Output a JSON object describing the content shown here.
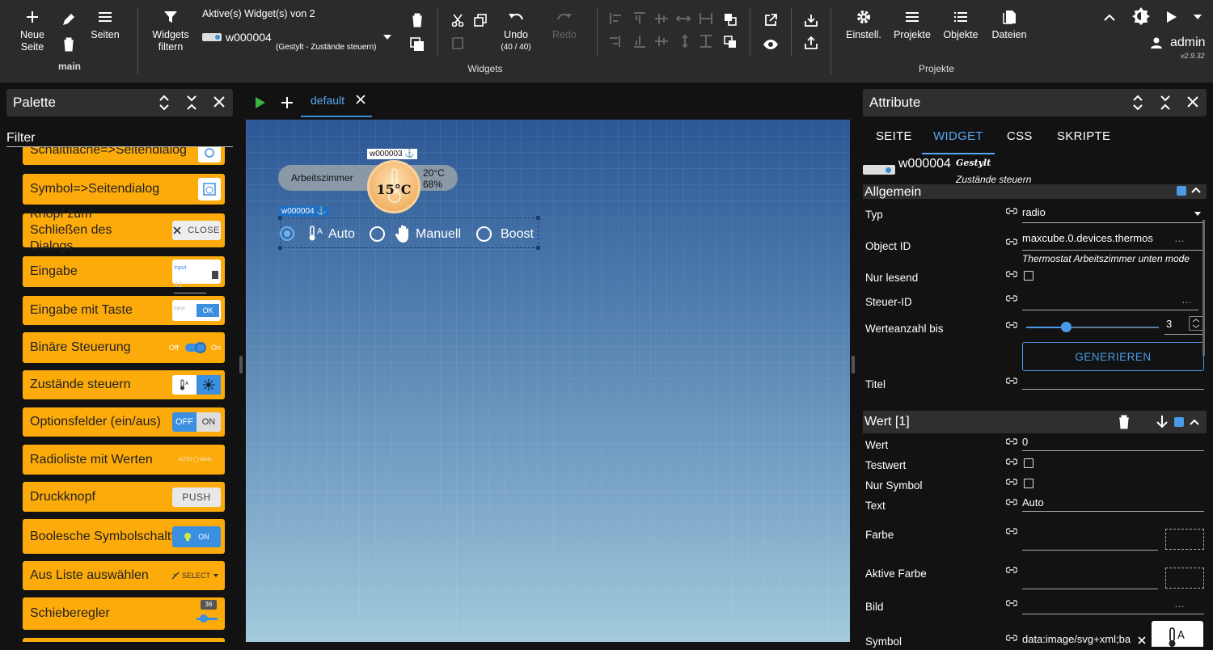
{
  "toolbar": {
    "new_page": "Neue\nSeite",
    "pages": "Seiten",
    "group_main": "main",
    "filter": "Widgets\nfiltern",
    "active_label": "Aktive(s) Widget(s) von 2",
    "widget_id": "w000004",
    "widget_desc": "(Gestylt - Zustände steuern)",
    "undo": "Undo",
    "undo_count": "(40 / 40)",
    "redo": "Redo",
    "group_widgets": "Widgets",
    "settings": "Einstell.",
    "projects": "Projekte",
    "objects": "Objekte",
    "files": "Dateien",
    "group_projects": "Projekte",
    "user": "admin",
    "version": "v2.9.32"
  },
  "palette": {
    "title": "Palette",
    "filter": "Filter",
    "items": [
      {
        "label": "Schaltfläche=>Seitendialog"
      },
      {
        "label": "Symbol=>Seitendialog"
      },
      {
        "label": "Knopf zum Schließen des Dialogs",
        "preview": "CLOSE"
      },
      {
        "label": "Eingabe",
        "preview_label": "Input",
        "preview_value": "42"
      },
      {
        "label": "Eingabe mit Taste",
        "preview_label": "Input",
        "preview_btn": "OK"
      },
      {
        "label": "Binäre Steuerung",
        "off": "Off",
        "on": "On"
      },
      {
        "label": "Zustände steuern"
      },
      {
        "label": "Optionsfelder (ein/aus)",
        "off": "OFF",
        "on": "ON"
      },
      {
        "label": "Radioliste mit Werten",
        "preview": "AUTO ◯ MAN"
      },
      {
        "label": "Druckknopf",
        "preview": "PUSH"
      },
      {
        "label": "Boolesche Symbolschaltfläche",
        "preview": "ON"
      },
      {
        "label": "Aus Liste auswählen",
        "preview": "SELECT"
      },
      {
        "label": "Schieberegler",
        "preview": "36"
      }
    ]
  },
  "editor": {
    "tab": "default",
    "w3": {
      "id": "w000003",
      "room": "Arbeitszimmer",
      "temp": "15°C",
      "setpoint": "20°C",
      "humidity": "68%"
    },
    "w4": {
      "id": "w000004",
      "options": [
        "Auto",
        "Manuell",
        "Boost"
      ]
    }
  },
  "attributes": {
    "title": "Attribute",
    "tabs": [
      "SEITE",
      "WIDGET",
      "CSS",
      "SKRIPTE"
    ],
    "widget_id": "w000004",
    "widget_style": "Gestylt",
    "widget_name": "Zustände steuern",
    "general": {
      "title": "Allgemein",
      "type_label": "Typ",
      "type_value": "radio",
      "oid_label": "Object ID",
      "oid_value": "maxcube.0.devices.thermos",
      "oid_desc": "Thermostat Arbeitszimmer unten mode",
      "readonly_label": "Nur lesend",
      "ctrl_label": "Steuer-ID",
      "count_label": "Werteanzahl bis",
      "count_value": "3",
      "generate": "GENERIEREN",
      "title_label": "Titel"
    },
    "value": {
      "title": "Wert [1]",
      "val_label": "Wert",
      "val_value": "0",
      "test_label": "Testwert",
      "symbol_only_label": "Nur Symbol",
      "text_label": "Text",
      "text_value": "Auto",
      "color_label": "Farbe",
      "active_color_label": "Aktive Farbe",
      "image_label": "Bild",
      "symbol_label": "Symbol",
      "symbol_value": "data:image/svg+xml;ba"
    }
  }
}
